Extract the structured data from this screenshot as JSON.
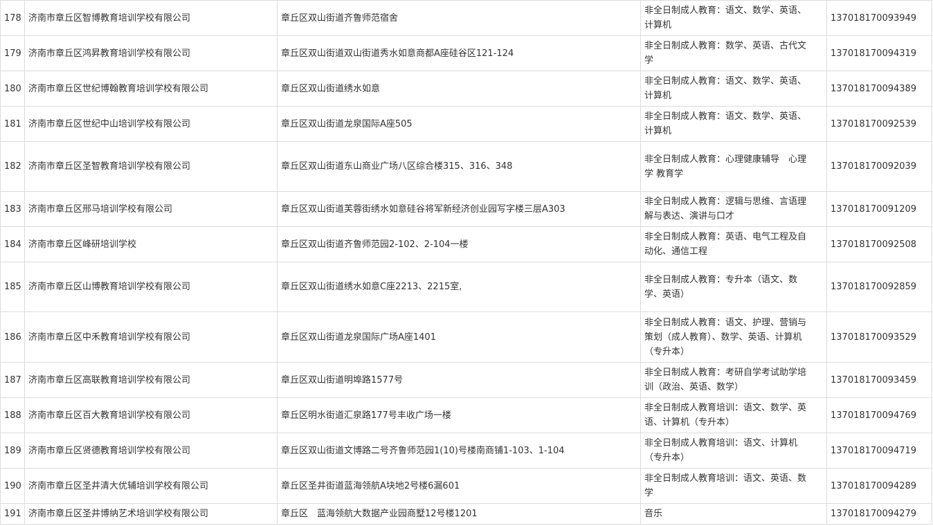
{
  "rows": [
    {
      "no": "178",
      "name": "济南市章丘区智博教育培训学校有限公司",
      "address": "章丘区双山街道齐鲁师范宿舍",
      "scope_lines": [
        "非全日制成人教育：语文、数学、英语、",
        "计算机"
      ],
      "license": "137018170093949"
    },
    {
      "no": "179",
      "name": "济南市章丘区鸿昇教育培训学校有限公司",
      "address": "章丘区双山街道双山街道秀水如意商都A座硅谷区121-124",
      "scope_lines": [
        "非全日制成人教育：数学、英语、古代文",
        "学"
      ],
      "license": "137018170094319"
    },
    {
      "no": "180",
      "name": "济南市章丘区世纪博翰教育培训学校有限公司",
      "address": "章丘区双山街道绣水如意",
      "scope_lines": [
        "非全日制成人教育：语文、数学、英语、",
        "计算机"
      ],
      "license": "137018170094389"
    },
    {
      "no": "181",
      "name": "济南市章丘区世纪中山培训学校有限公司",
      "address": "章丘区双山街道龙泉国际A座505",
      "scope_lines": [
        "非全日制成人教育：语文、数学、英语、",
        "计算机"
      ],
      "license": "137018170092539"
    },
    {
      "no": "182",
      "name": "济南市章丘区圣智教育培训学校有限公司",
      "address": "章丘区双山街道东山商业广场八区综合楼315、316、348",
      "scope_lines": [
        "非全日制成人教育：心理健康辅导　心理",
        "学 教育学"
      ],
      "license": "137018170092039"
    },
    {
      "no": "183",
      "name": "济南市章丘区邢马培训学校有限公司",
      "address": "章丘区双山街道芙蓉街绣水如意硅谷将军新经济创业园写字楼三层A303",
      "scope_lines": [
        "非全日制成人教育：逻辑与思维、言语理",
        "解与表达、演讲与口才"
      ],
      "license": "137018170091209"
    },
    {
      "no": "184",
      "name": "济南市章丘区峰研培训学校",
      "address": "章丘区双山街道齐鲁师范园2-102、2-104一楼",
      "scope_lines": [
        "非全日制成人教育：英语、电气工程及自",
        "动化、通信工程"
      ],
      "license": "137018170092508"
    },
    {
      "no": "185",
      "name": "济南市章丘区山博教育培训学校有限公司",
      "address": "章丘区双山街道绣水如意C座2213、2215室,",
      "scope_lines": [
        "非全日制成人教育：专升本（语文、数",
        "学、英语）"
      ],
      "license": "137018170092859"
    },
    {
      "no": "186",
      "name": "济南市章丘区中禾教育培训学校有限公司",
      "address": "章丘区双山街道龙泉国际广场A座1401",
      "scope_lines": [
        "非全日制成人教育：语文、护理、营销与",
        "策划（成人教育）、数学、英语、计算机",
        "（专升本）"
      ],
      "license": "137018170093529"
    },
    {
      "no": "187",
      "name": "济南市章丘区高联教育培训学校有限公司",
      "address": "章丘区双山街道明埠路1577号",
      "scope_lines": [
        "非全日制成人教育：考研自学考试助学培",
        "训（政治、英语、数学）"
      ],
      "license": "137018170093459"
    },
    {
      "no": "188",
      "name": "济南市章丘区百大教育培训学校有限公司",
      "address": "章丘区明水街道汇泉路177号丰收广场一楼",
      "scope_lines": [
        "非全日制成人教育培训：语文、数学、英",
        "语、计算机（专升本）"
      ],
      "license": "137018170094769"
    },
    {
      "no": "189",
      "name": "济南市章丘区贤德教育培训学校有限公司",
      "address": "章丘区双山街道文博路二号齐鲁师范园1(10)号楼南商铺1-103、1-104",
      "scope_lines": [
        "非全日制成人教育培训：语文、计算机",
        "（专升本）"
      ],
      "license": "137018170094719"
    },
    {
      "no": "190",
      "name": "济南市章丘区圣井清大优辅培训学校有限公司",
      "address": "章丘区圣井街道蓝海领航A块地2号楼6漏601",
      "scope_lines": [
        "非全日制成人教育培训：语文、英语、数",
        "学"
      ],
      "license": "137018170094289"
    },
    {
      "no": "191",
      "name": "济南市章丘区圣井博纳艺术培训学校有限公司",
      "address": "章丘区　蓝海领航大数据产业园商墅12号楼1201",
      "scope_lines": [
        "音乐"
      ],
      "license": "137018170094279"
    }
  ]
}
